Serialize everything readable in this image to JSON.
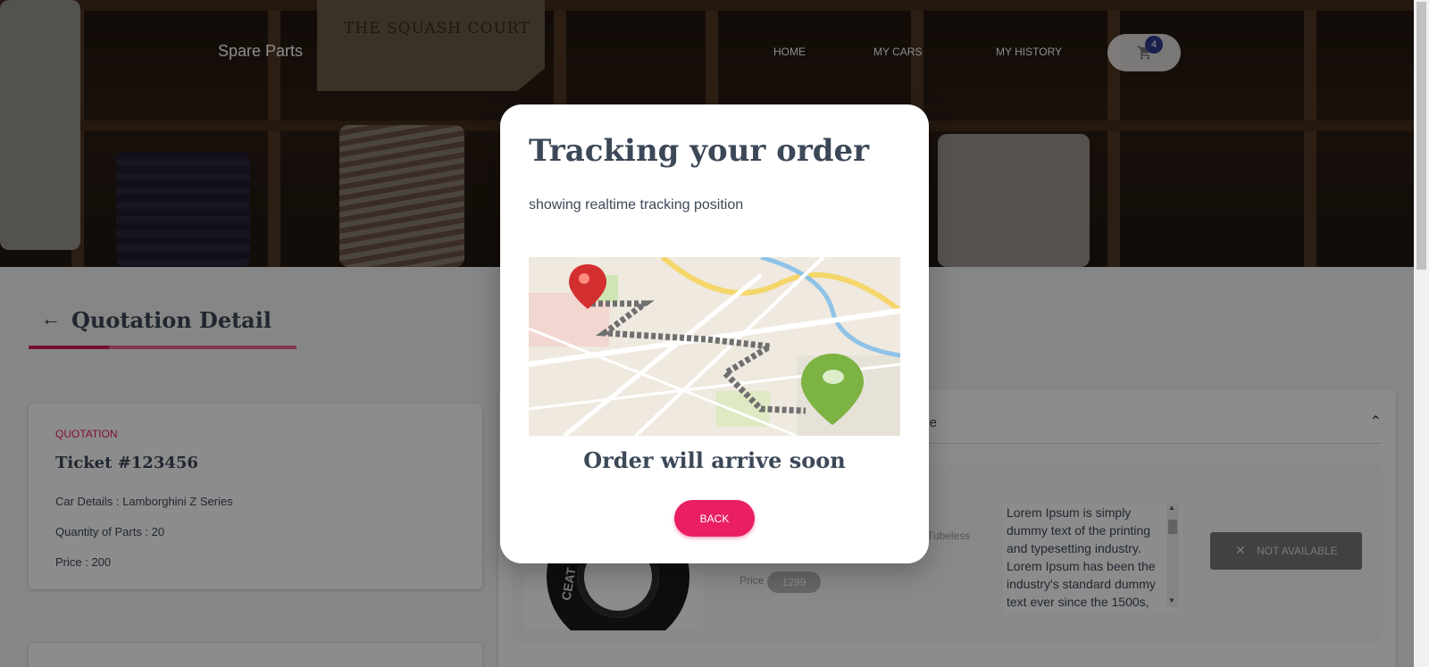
{
  "header": {
    "brand": "Spare Parts",
    "tag_text": "THE SQUASH COURT",
    "nav": [
      {
        "label": "HOME"
      },
      {
        "label": "MY CARS"
      },
      {
        "label": "MY HISTORY"
      }
    ],
    "cart_count": "4",
    "cart_icon": "shopping-cart-icon"
  },
  "page": {
    "back_icon": "arrow-left-icon",
    "title": "Quotation Detail"
  },
  "quotation": {
    "kicker": "QUOTATION",
    "ticket": "Ticket #123456",
    "car_details": "Car Details : Lamborghini Z Series",
    "quantity": "Quantity of Parts : 20",
    "price": "Price : 200"
  },
  "part_panel": {
    "header_visible_text": "ilable",
    "chevron_icon": "chevron-up-icon",
    "tyre_brand_text": "CEAT",
    "tubeless_text": "Tubeless",
    "price_label": "Price",
    "price_value": "1299",
    "description": "Lorem Ipsum is simply dummy text of the printing and typesetting industry. Lorem Ipsum has been the industry's standard dummy text ever since the 1500s,",
    "not_available_label": "NOT AVAILABLE",
    "not_available_icon": "close-icon"
  },
  "modal": {
    "title": "Tracking your order",
    "subtitle": "showing realtime tracking position",
    "arrival": "Order will arrive soon",
    "back_label": "BACK",
    "map_icons": [
      "start-pin-icon",
      "destination-pin-icon"
    ]
  },
  "colors": {
    "accent": "#e91e63",
    "text": "#3c4858",
    "badge": "#2f3b8f",
    "pin_start": "#d32f2f",
    "pin_end": "#7cb342"
  }
}
